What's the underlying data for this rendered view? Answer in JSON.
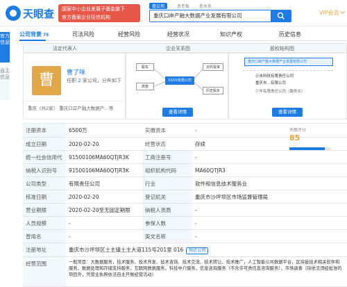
{
  "header": {
    "logo_text": "天眼查",
    "banner_line1": "国家中小企业发展子基金旗下",
    "banner_line2": "官方备案企业征信机构",
    "search_tabs": [
      "查公司",
      "查老板",
      "查关系"
    ],
    "search_value": "重庆口岸产融大数据产业发展有限公司",
    "vip_label": "VIP会员"
  },
  "sidebar": {
    "primary": "官方信息",
    "secondary": "自主信息"
  },
  "nav": [
    {
      "label": "公司背景",
      "count": "75"
    },
    {
      "label": "司法风险",
      "count": ""
    },
    {
      "label": "经营风险",
      "count": ""
    },
    {
      "label": "经营状况",
      "count": ""
    },
    {
      "label": "知识产权",
      "count": ""
    },
    {
      "label": "历史信息",
      "count": ""
    }
  ],
  "strip": {
    "col1": "法定代表人",
    "col2": "企业关系图",
    "col3": "股权结构图"
  },
  "legal": {
    "avatar_char": "曹",
    "name": "曹了咪",
    "sub_prefix": "任职",
    "sub_count": "2",
    "sub_suffix": "家公司，分布如下",
    "relation_line": "重庆（共2家）  重庆口岸产融大数据产…等"
  },
  "graph_labels": {
    "center": "XXXX有限公司",
    "left_top": "股东",
    "left_bottom": "高管",
    "right_top": "对外投资",
    "right_bottom": "历史股东",
    "view": "查看详情"
  },
  "equity": {
    "top": "重庆口岸产融大数据产业发展有限公司",
    "row1": "小米科技有限责任公司",
    "row2": "重庆市…有限公司",
    "row3": "少年有限责任公司（服务业）",
    "view": "查看详情"
  },
  "table": {
    "rows": [
      {
        "l1": "注册资本",
        "v1": "6500万",
        "l2": "实缴资本",
        "v2": "-"
      },
      {
        "l1": "成立日期",
        "v1": "2020-02-20",
        "l2": "经营状态",
        "v2": "存续"
      },
      {
        "l1": "统一社会信用代码",
        "v1": "91500106MA60QTJR3K",
        "l2": "工商注册号",
        "v2": "-"
      },
      {
        "l1": "纳税人识别号",
        "v1": "91500106MA60QTJR3K",
        "l2": "组织机构代码",
        "v2": "MA60QTJR3"
      },
      {
        "l1": "公司类型",
        "v1": "有限责任公司",
        "l2": "行业",
        "v2": "软件和信息技术服务业"
      },
      {
        "l1": "核准日期",
        "v1": "2020-02-20",
        "l2": "登记机关",
        "v2": "重庆市沙坪坝区市场监督管理局"
      },
      {
        "l1": "营业期限",
        "v1": "2020-02-20至无固定期限",
        "l2": "纳税人资质",
        "v2": "-"
      },
      {
        "l1": "人员规模",
        "v1": "-",
        "l2": "参保人数",
        "v2": "-"
      },
      {
        "l1": "曾用名",
        "v1": "-",
        "l2": "英文名称",
        "v2": "-"
      }
    ],
    "address_label": "注册地址",
    "address_value": "重庆市沙坪坝区土主镇土主大道115号201室 016",
    "address_btn": "附近公司",
    "scope_label": "经营范围",
    "scope_value": "一般项目：大数据服务，技术服务、技术开发、技术咨询、技术交流、技术转让、技术推广，人工智能公共数据平台，区块链技术相关软件和服务，数据处理和存储支持服务，互联网数据服务，科技中介服务，信息咨询服务（不含许可类信息咨询服务），市场调查（除依法须经批准的项目外，凭营业执照依法自主开展经营活动）",
    "score_label": "天眼评分",
    "score_value": "85"
  }
}
